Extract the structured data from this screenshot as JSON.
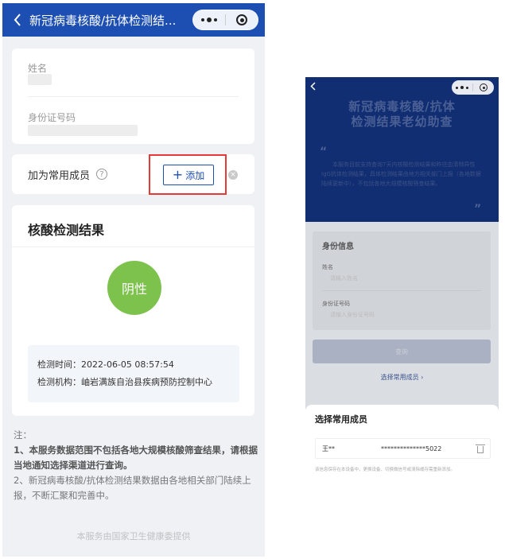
{
  "left": {
    "nav": {
      "back_icon": "chevron-left-icon",
      "title": "新冠病毒核酸/抗体检测结..."
    },
    "person": {
      "name_label": "姓名",
      "id_label": "身份证号码"
    },
    "member": {
      "label": "加为常用成员",
      "help_glyph": "?",
      "add_plus": "+",
      "add_label": "添加",
      "clear_glyph": "×"
    },
    "result": {
      "title": "核酸检测结果",
      "status": "阴性",
      "status_color": "#7dc24d",
      "time_line": "检测时间：2022-06-05 08:57:54",
      "org_line": "检测机构：岫岩满族自治县疾病预防控制中心"
    },
    "notes": {
      "heading": "注：",
      "item1": "1、本服务数据范围不包括各地大规模核酸筛查结果，请根据当地通知选择渠道进行查询。",
      "item2": "2、新冠病毒核酸/抗体检测结果数据由各地相关部门陆续上报，不断汇聚和完善中。"
    },
    "footer": "本服务由国家卫生健康委提供"
  },
  "right": {
    "nav": {
      "back_icon": "chevron-left-icon"
    },
    "hero": {
      "title_line1": "新冠病毒核酸/抗体",
      "title_line2": "检测结果老幼助查",
      "open_quote": "“",
      "close_quote": "”",
      "blurb": "本服务目前支持查询7天内核酸检测结果和昨往血清特异性IgG抗体检测结果，具体检测结果由地方相关部门上报（各地数据陆续更新中），不包括各地大规模核酸筛查结果。"
    },
    "idcard": {
      "title": "身份信息",
      "name_label": "姓名",
      "name_placeholder": "请输入姓名",
      "id_label": "身份证号码",
      "id_placeholder": "请输入身份证号码"
    },
    "query_button": "查询",
    "select_link": "选择常用成员 ›",
    "sheet": {
      "title": "选择常用成员",
      "member_name": "王**",
      "member_id": "**************5022",
      "tip": "该信息保存在本设备中，更换设备、切换微信号或清除缓存需重新添加。"
    }
  },
  "colors": {
    "nav_blue": "#1d4fb3",
    "hero_navy": "#112e73",
    "highlight_red": "#e63a3a"
  }
}
